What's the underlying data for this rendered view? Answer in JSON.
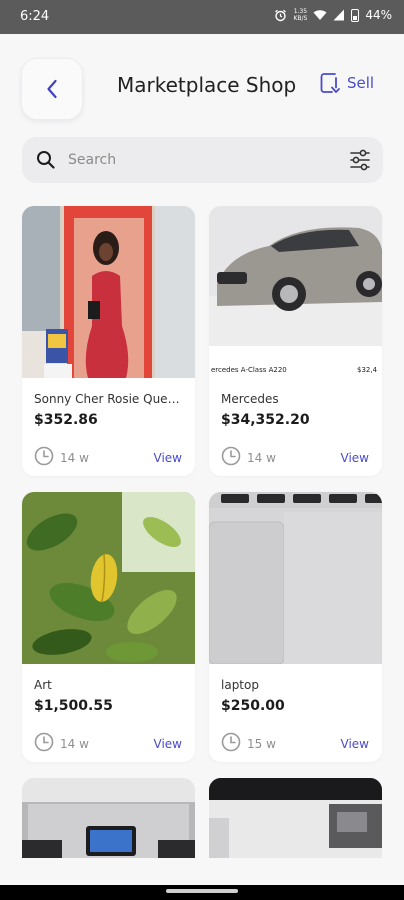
{
  "status_bar": {
    "time": "6:24",
    "net_speed_value": "1.35",
    "net_speed_unit": "KB/S",
    "battery": "44%"
  },
  "header": {
    "title": "Marketplace Shop",
    "sell_label": "Sell",
    "accent_color": "#4a4cc7"
  },
  "search": {
    "placeholder": "Search"
  },
  "products": [
    {
      "title": "Sonny Cher Rosie Queen...",
      "price": "$352.86",
      "age": "14 w",
      "action": "View",
      "image": "doll-in-box"
    },
    {
      "title": "Mercedes",
      "price": "$34,352.20",
      "age": "14 w",
      "action": "View",
      "image": "silver-sedan",
      "image_caption_left": "ercedes A-Class A220",
      "image_caption_right": "$32,4"
    },
    {
      "title": "Art",
      "price": "$1,500.55",
      "age": "14 w",
      "action": "View",
      "image": "green-leaves"
    },
    {
      "title": "laptop",
      "price": "$250.00",
      "age": "15 w",
      "action": "View",
      "image": "laptop-keyboard"
    }
  ],
  "icons": {
    "back": "chevron-left-icon",
    "sell": "sell-icon",
    "search": "search-icon",
    "filter": "sliders-icon",
    "clock": "clock-icon"
  }
}
